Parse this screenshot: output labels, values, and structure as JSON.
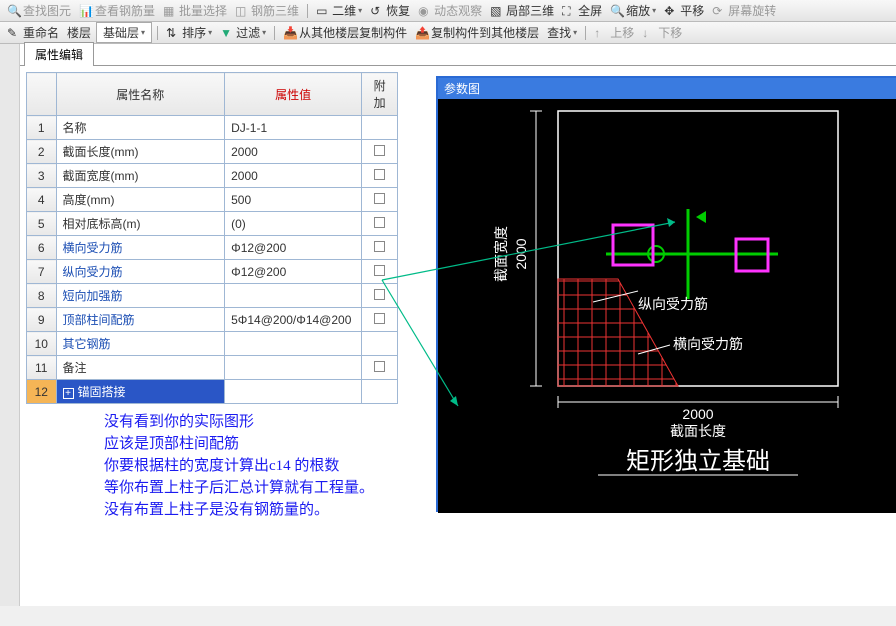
{
  "toolbar1": {
    "items": [
      "查找图元",
      "查看钢筋量",
      "批量选择",
      "钢筋三维"
    ],
    "right_items": [
      "二维",
      "恢复",
      "动态观察",
      "局部三维",
      "全屏",
      "缩放",
      "平移",
      "屏幕旋转"
    ]
  },
  "toolbar2": {
    "items": [
      "重命名",
      "楼层",
      "基础层",
      "排序",
      "过滤",
      "从其他楼层复制构件",
      "复制构件到其他楼层",
      "查找"
    ],
    "nav": [
      "上移",
      "下移"
    ]
  },
  "tab": {
    "label": "属性编辑"
  },
  "table": {
    "headers": {
      "name": "属性名称",
      "value": "属性值",
      "extra": "附加"
    },
    "rows": [
      {
        "n": "1",
        "name": "名称",
        "value": "DJ-1-1",
        "chk": false,
        "link": false
      },
      {
        "n": "2",
        "name": "截面长度(mm)",
        "value": "2000",
        "chk": true,
        "link": false
      },
      {
        "n": "3",
        "name": "截面宽度(mm)",
        "value": "2000",
        "chk": true,
        "link": false
      },
      {
        "n": "4",
        "name": "高度(mm)",
        "value": "500",
        "chk": true,
        "link": false
      },
      {
        "n": "5",
        "name": "相对底标高(m)",
        "value": "(0)",
        "chk": true,
        "link": false
      },
      {
        "n": "6",
        "name": "横向受力筋",
        "value": "Φ12@200",
        "chk": true,
        "link": true
      },
      {
        "n": "7",
        "name": "纵向受力筋",
        "value": "Φ12@200",
        "chk": true,
        "link": true
      },
      {
        "n": "8",
        "name": "短向加强筋",
        "value": "",
        "chk": true,
        "link": true
      },
      {
        "n": "9",
        "name": "顶部柱间配筋",
        "value": "5Φ14@200/Φ14@200",
        "chk": true,
        "link": true
      },
      {
        "n": "10",
        "name": "其它钢筋",
        "value": "",
        "chk": false,
        "link": true
      },
      {
        "n": "11",
        "name": "备注",
        "value": "",
        "chk": true,
        "link": false
      },
      {
        "n": "12",
        "name": "锚固搭接",
        "value": "",
        "chk": false,
        "link": false,
        "expand": true,
        "selected": true
      }
    ]
  },
  "diagram": {
    "title": "参数图",
    "labels": {
      "y_dim": "2000",
      "y_axis": "截面宽度",
      "x_dim": "2000",
      "x_axis": "截面长度",
      "vert_rebar": "纵向受力筋",
      "horiz_rebar": "横向受力筋",
      "caption": "矩形独立基础"
    }
  },
  "annotation": {
    "l1": "没有看到你的实际图形",
    "l2": "应该是顶部柱间配筋",
    "l3": "你要根据柱的宽度计算出c14 的根数",
    "l4": "等你布置上柱子后汇总计算就有工程量。",
    "l5": "没有布置上柱子是没有钢筋量的。"
  }
}
